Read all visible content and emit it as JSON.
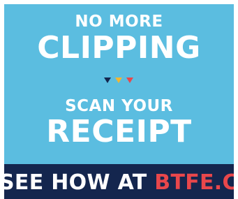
{
  "ad": {
    "line1": "NO MORE",
    "line2": "CLIPPING",
    "line3": "SCAN YOUR",
    "line4": "RECEIPT",
    "cta_lead": "SEE HOW AT ",
    "cta_url": "BTFE.COM"
  },
  "divider": {
    "colors": [
      "#14264e",
      "#f2b632",
      "#e8474b"
    ]
  },
  "colors": {
    "panel_bg": "#5bbde0",
    "footer_bg": "#14264e",
    "accent": "#e8474b",
    "text": "#ffffff"
  }
}
